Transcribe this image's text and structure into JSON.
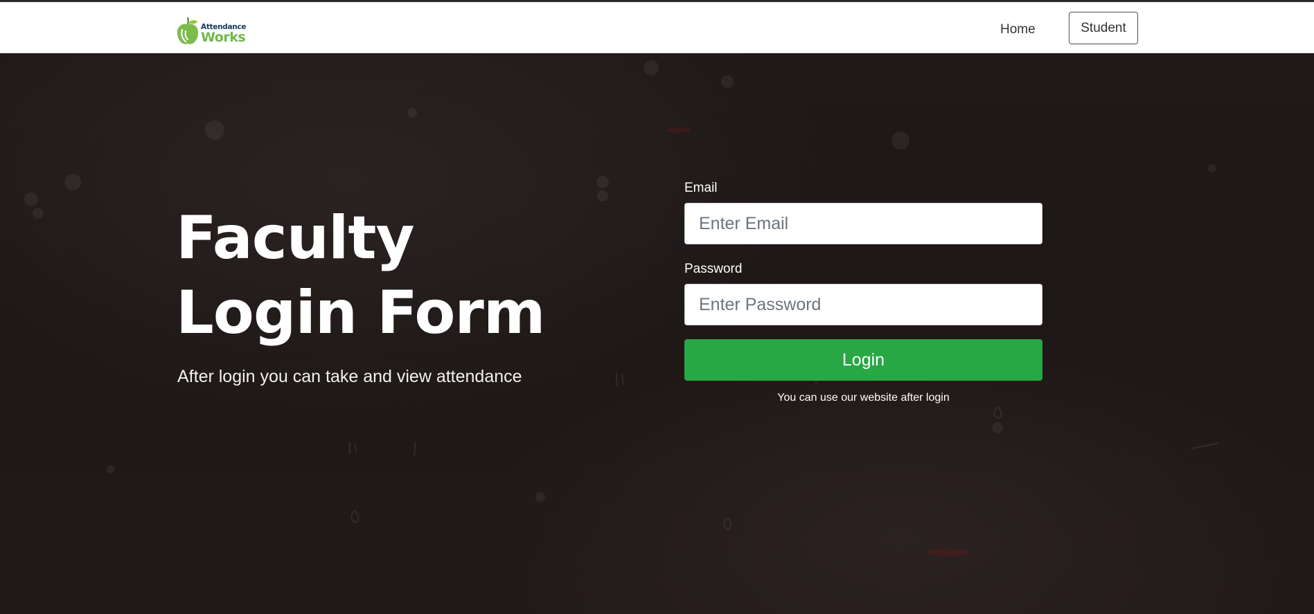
{
  "navbar": {
    "logo_top": "Attendance",
    "logo_bottom": "Works",
    "home_label": "Home",
    "student_label": "Student"
  },
  "hero": {
    "title_line1": "Faculty",
    "title_line2": "Login Form",
    "subtitle": "After login you can take and view attendance"
  },
  "form": {
    "email_label": "Email",
    "email_placeholder": "Enter Email",
    "email_value": "",
    "password_label": "Password",
    "password_placeholder": "Enter Password",
    "password_value": "",
    "login_label": "Login",
    "note": "You can use our website after login"
  },
  "colors": {
    "accent": "#28a745",
    "background": "#1d1716",
    "navbar": "#ffffff",
    "logo_green": "#6fb84a",
    "logo_navy": "#14395a"
  },
  "icons": {
    "logo": "apple-logo-icon"
  }
}
